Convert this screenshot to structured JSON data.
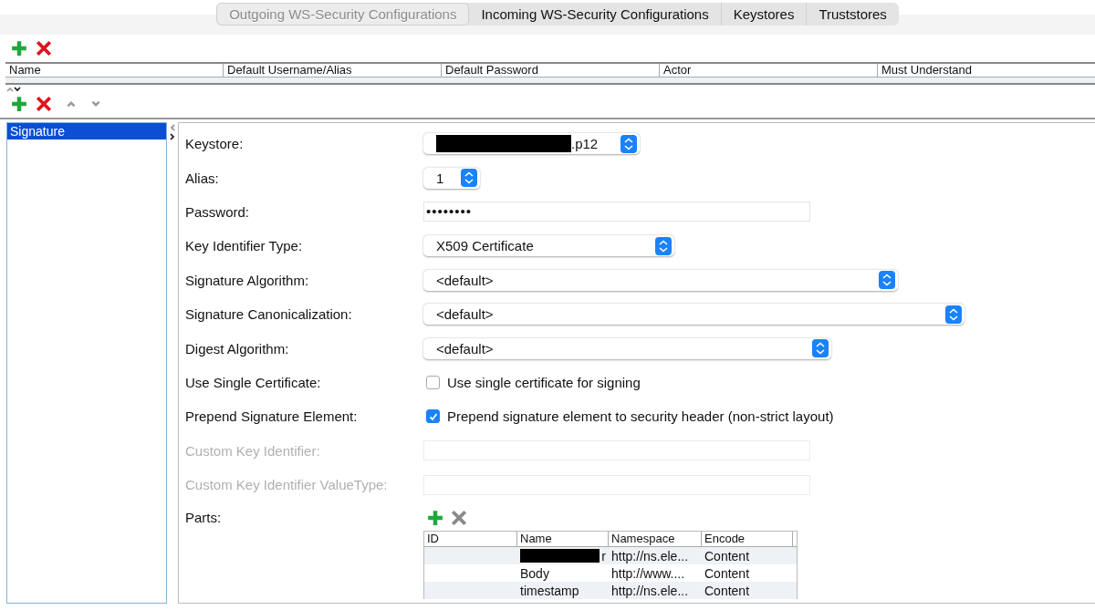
{
  "tabs": [
    {
      "label": "Outgoing WS-Security Configurations",
      "selected": true
    },
    {
      "label": "Incoming WS-Security Configurations",
      "selected": false
    },
    {
      "label": "Keystores",
      "selected": false
    },
    {
      "label": "Truststores",
      "selected": false
    }
  ],
  "config_table": {
    "columns": [
      "Name",
      "Default Username/Alias",
      "Default Password",
      "Actor",
      "Must Understand"
    ]
  },
  "entries": [
    {
      "label": "Signature",
      "selected": true
    }
  ],
  "form": [
    {
      "kind": "select",
      "label": "Keystore:",
      "value": ".p12",
      "redacted": true
    },
    {
      "kind": "select",
      "label": "Alias:",
      "value": "1"
    },
    {
      "kind": "password",
      "label": "Password:",
      "value": "••••••••"
    },
    {
      "kind": "select",
      "label": "Key Identifier Type:",
      "value": "X509 Certificate"
    },
    {
      "kind": "select",
      "label": "Signature Algorithm:",
      "value": "<default>"
    },
    {
      "kind": "select",
      "label": "Signature Canonicalization:",
      "value": "<default>"
    },
    {
      "kind": "select",
      "label": "Digest Algorithm:",
      "value": "<default>"
    },
    {
      "kind": "checkbox",
      "label": "Use Single Certificate:",
      "text": "Use single certificate for signing",
      "checked": false
    },
    {
      "kind": "checkbox",
      "label": "Prepend Signature Element:",
      "text": "Prepend signature element to security header (non-strict layout)",
      "checked": true
    },
    {
      "kind": "text",
      "label": "Custom Key Identifier:",
      "disabled": true
    },
    {
      "kind": "text",
      "label": "Custom Key Identifier ValueType:",
      "disabled": true
    }
  ],
  "parts": {
    "label": "Parts:",
    "remove_disabled": true,
    "columns": [
      "ID",
      "Name",
      "Namespace",
      "Encode"
    ],
    "rows": [
      {
        "name": "r",
        "redacted": true,
        "namespace": "http://ns.ele...",
        "encode": "Content"
      },
      {
        "name": "Body",
        "namespace": "http://www....",
        "encode": "Content"
      },
      {
        "name": "timestamp",
        "namespace": "http://ns.ele...",
        "encode": "Content"
      }
    ]
  }
}
